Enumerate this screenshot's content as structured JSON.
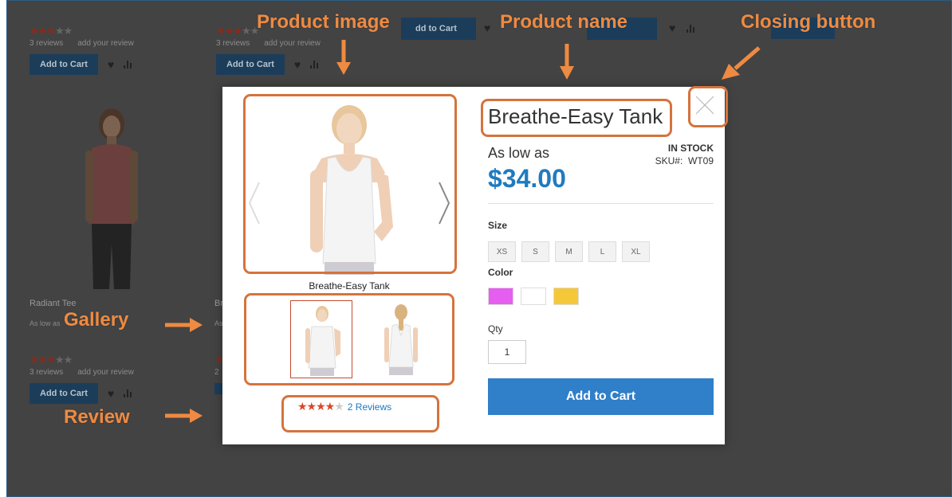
{
  "background": {
    "cards": [
      {
        "reviews": "3  reviews",
        "add_review": "add your review",
        "add_to_cart": "Add to Cart"
      },
      {
        "reviews": "3  reviews",
        "add_review": "add your review",
        "add_to_cart": "Add to Cart"
      }
    ],
    "partial_buttons": [
      "dd to Cart",
      "Add to Cart"
    ],
    "lower_card": {
      "name": "Radiant Tee",
      "price": "As low as",
      "reviews": "3  reviews",
      "add_review": "add your review",
      "add_to_cart": "Add to Cart"
    },
    "lower_card_2": {
      "name": "Br",
      "price": "As",
      "reviews": "2"
    }
  },
  "modal": {
    "product_name": "Breathe-Easy Tank",
    "as_low_as": "As low as",
    "price": "$34.00",
    "stock": "IN STOCK",
    "sku_label": "SKU#:",
    "sku_value": "WT09",
    "image_caption": "Breathe-Easy Tank",
    "size_label": "Size",
    "sizes": [
      "XS",
      "S",
      "M",
      "L",
      "XL"
    ],
    "color_label": "Color",
    "colors": [
      "#e65ef0",
      "#ffffff",
      "#f5c83a"
    ],
    "qty_label": "Qty",
    "qty_value": "1",
    "add_to_cart": "Add to Cart",
    "rating_percent": 70,
    "reviews_link": "2 Reviews"
  },
  "annotations": {
    "product_image": "Product image",
    "product_name": "Product name",
    "closing_button": "Closing button",
    "gallery": "Gallery",
    "review": "Review"
  },
  "colors": {
    "accent": "#ee8a41",
    "brand_blue": "#1f7bc0",
    "button_blue": "#2f7fc9",
    "overlay": "#434343"
  }
}
